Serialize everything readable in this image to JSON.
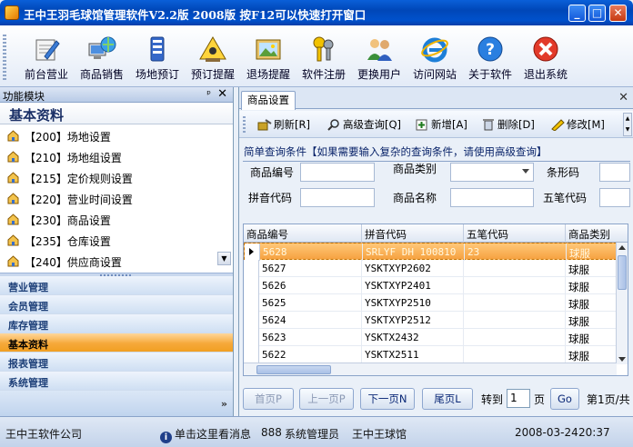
{
  "window": {
    "title": "王中王羽毛球馆管理软件V2.2版 2008版 按F12可以快速打开窗口"
  },
  "toolbar": {
    "buttons": [
      {
        "label": "前台营业",
        "icon": "pencil-notepad-icon"
      },
      {
        "label": "商品销售",
        "icon": "computer-globe-icon"
      },
      {
        "label": "场地预订",
        "icon": "book-stack-icon"
      },
      {
        "label": "预订提醒",
        "icon": "alert-sign-icon"
      },
      {
        "label": "退场提醒",
        "icon": "picture-frame-icon"
      },
      {
        "label": "软件注册",
        "icon": "keys-icon"
      },
      {
        "label": "更换用户",
        "icon": "users-icon"
      },
      {
        "label": "访问网站",
        "icon": "internet-explorer-icon"
      },
      {
        "label": "关于软件",
        "icon": "help-icon"
      },
      {
        "label": "退出系统",
        "icon": "exit-icon"
      }
    ]
  },
  "sidebar": {
    "header": "功能模块",
    "pin": "ᵖ",
    "close": "✕",
    "section_title": "基本资料",
    "items": [
      {
        "label": "【200】场地设置"
      },
      {
        "label": "【210】场地组设置"
      },
      {
        "label": "【215】定价规则设置"
      },
      {
        "label": "【220】营业时间设置"
      },
      {
        "label": "【230】商品设置"
      },
      {
        "label": "【235】仓库设置"
      },
      {
        "label": "【240】供应商设置"
      }
    ],
    "groups": [
      {
        "label": "营业管理",
        "active": false
      },
      {
        "label": "会员管理",
        "active": false
      },
      {
        "label": "库存管理",
        "active": false
      },
      {
        "label": "基本资料",
        "active": true
      },
      {
        "label": "报表管理",
        "active": false
      },
      {
        "label": "系统管理",
        "active": false
      }
    ],
    "more": "»"
  },
  "content": {
    "tab": "商品设置",
    "tab_close": "✕",
    "actions": [
      {
        "label": "刷新[R]",
        "icon": "refresh-icon"
      },
      {
        "label": "高级查询[Q]",
        "icon": "magnifier-icon"
      },
      {
        "label": "新增[A]",
        "icon": "add-icon"
      },
      {
        "label": "删除[D]",
        "icon": "delete-icon"
      },
      {
        "label": "修改[M]",
        "icon": "edit-icon"
      }
    ],
    "query": {
      "title": "简单查询条件【如果需要输入复杂的查询条件，请使用高级查询】",
      "labels": {
        "code": "商品编号",
        "category": "商品类别",
        "barcode": "条形码",
        "pinyin": "拼音代码",
        "name": "商品名称",
        "wubi": "五笔代码"
      },
      "values": {
        "code": "",
        "category": "",
        "barcode": "",
        "pinyin": "",
        "name": "",
        "wubi": ""
      }
    },
    "grid": {
      "columns": [
        "商品编号",
        "拼音代码",
        "五笔代码",
        "商品类别"
      ],
      "rows": [
        {
          "code": "5628",
          "pinyin": "SRLYF DH 100810",
          "wubi": "23",
          "category": "球服",
          "selected": true
        },
        {
          "code": "5627",
          "pinyin": "YSKTXYP2602",
          "wubi": "",
          "category": "球服",
          "selected": false
        },
        {
          "code": "5626",
          "pinyin": "YSKTXYP2401",
          "wubi": "",
          "category": "球服",
          "selected": false
        },
        {
          "code": "5625",
          "pinyin": "YSKTXYP2510",
          "wubi": "",
          "category": "球服",
          "selected": false
        },
        {
          "code": "5624",
          "pinyin": "YSKTXYP2512",
          "wubi": "",
          "category": "球服",
          "selected": false
        },
        {
          "code": "5623",
          "pinyin": "YSKTX2432",
          "wubi": "",
          "category": "球服",
          "selected": false
        },
        {
          "code": "5622",
          "pinyin": "YSKTX2511",
          "wubi": "",
          "category": "球服",
          "selected": false
        }
      ]
    },
    "pager": {
      "first": "首页P",
      "prev": "上一页P",
      "next": "下一页N",
      "last": "尾页L",
      "goto_label": "转到",
      "page_value": "1",
      "page_unit": "页",
      "go": "Go",
      "summary": "第1页/共"
    }
  },
  "status": {
    "company": "王中王软件公司",
    "message": "单击这里看消息",
    "user_id": "888",
    "user_name": "系统管理员",
    "venue": "王中王球馆",
    "date": "2008-03-24",
    "time": "20:37"
  }
}
